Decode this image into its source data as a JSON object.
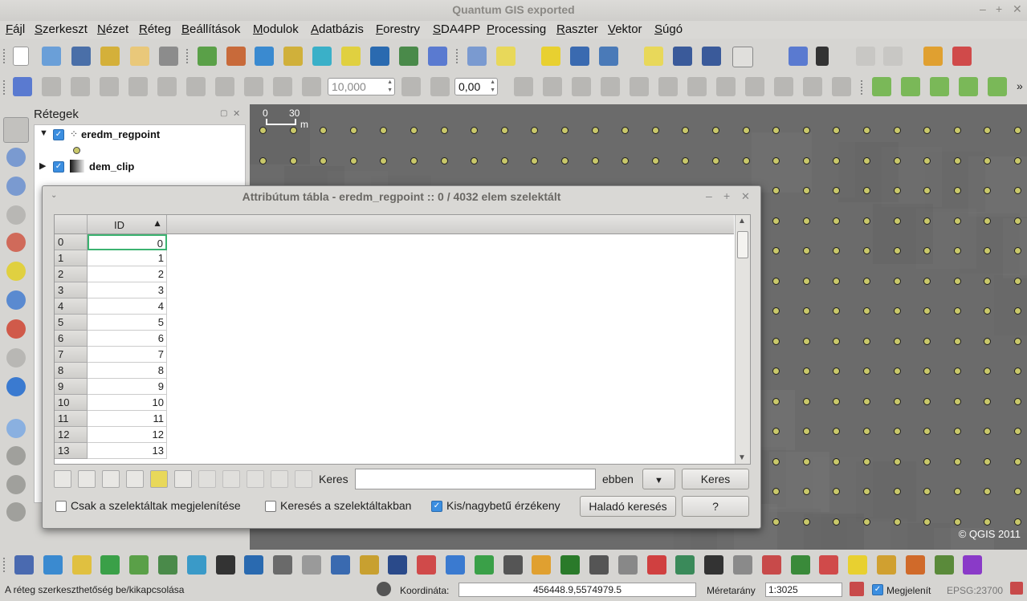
{
  "window": {
    "title": "Quantum GIS exported",
    "min": "–",
    "max": "+",
    "close": "✕"
  },
  "menu": [
    "Fájl",
    "Szerkeszt",
    "Nézet",
    "Réteg",
    "Beállítások",
    "Modulok",
    "Adatbázis",
    "Forestry",
    "SDA4PP",
    "Processing",
    "Raszter",
    "Vektor",
    "Súgó"
  ],
  "toolbar2": {
    "tolerance": "10,000",
    "offset": "0,00"
  },
  "layers_panel": {
    "title": "Rétegek",
    "layers": [
      {
        "name": "eredm_regpoint",
        "visible": true
      },
      {
        "name": "dem_clip",
        "visible": true
      }
    ]
  },
  "map": {
    "scalebar": {
      "zero": "0",
      "value": "30",
      "unit": "m"
    },
    "copyright": "© QGIS 2011",
    "colors": {
      "background": "#6b6b6b",
      "point": "#c9c86a"
    }
  },
  "attr_dialog": {
    "title": "Attribútum tábla - eredm_regpoint :: 0 / 4032 elem szelektált",
    "column": "ID",
    "sort_indicator": "▲",
    "rows": [
      {
        "h": "0",
        "v": "0"
      },
      {
        "h": "1",
        "v": "1"
      },
      {
        "h": "2",
        "v": "2"
      },
      {
        "h": "3",
        "v": "3"
      },
      {
        "h": "4",
        "v": "4"
      },
      {
        "h": "5",
        "v": "5"
      },
      {
        "h": "6",
        "v": "6"
      },
      {
        "h": "7",
        "v": "7"
      },
      {
        "h": "8",
        "v": "8"
      },
      {
        "h": "9",
        "v": "9"
      },
      {
        "h": "10",
        "v": "10"
      },
      {
        "h": "11",
        "v": "11"
      },
      {
        "h": "12",
        "v": "12"
      },
      {
        "h": "13",
        "v": "13"
      }
    ],
    "search_label": "Keres",
    "in_label": "ebben",
    "search_button": "Keres",
    "only_selected": "Csak a szelektáltak megjelenítése",
    "search_selected": "Keresés a szelektáltakban",
    "case_sensitive": "Kis/nagybetű érzékeny",
    "advanced_button": "Haladó keresés",
    "help_button": "?"
  },
  "status": {
    "message": "A réteg szerkeszthetőség be/kikapcsolása",
    "coord_label": "Koordináta:",
    "coord_value": "456448.9,5574979.5",
    "scale_label": "Méretarány",
    "scale_value": "1:3025",
    "render_label": "Megjelenít",
    "crs": "EPSG:23700"
  }
}
